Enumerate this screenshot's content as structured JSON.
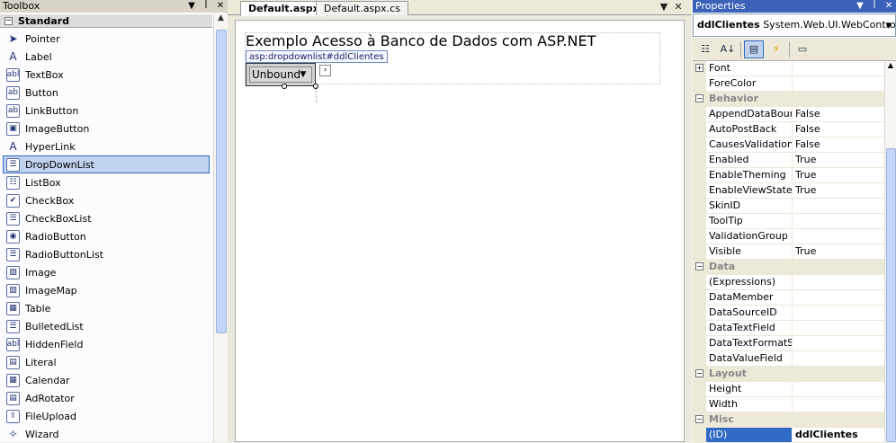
{
  "toolbox": {
    "title": "Toolbox",
    "group": "Standard",
    "items": [
      {
        "label": "Pointer",
        "icon": "pointer-icon",
        "glyph": "➤"
      },
      {
        "label": "Label",
        "icon": "label-icon",
        "glyph": "A"
      },
      {
        "label": "TextBox",
        "icon": "textbox-icon",
        "glyph": "abl"
      },
      {
        "label": "Button",
        "icon": "button-icon",
        "glyph": "ab"
      },
      {
        "label": "LinkButton",
        "icon": "linkbutton-icon",
        "glyph": "ab"
      },
      {
        "label": "ImageButton",
        "icon": "imagebutton-icon",
        "glyph": "▣"
      },
      {
        "label": "HyperLink",
        "icon": "hyperlink-icon",
        "glyph": "A"
      },
      {
        "label": "DropDownList",
        "icon": "dropdownlist-icon",
        "glyph": "☰"
      },
      {
        "label": "ListBox",
        "icon": "listbox-icon",
        "glyph": "☷"
      },
      {
        "label": "CheckBox",
        "icon": "checkbox-icon",
        "glyph": "✔"
      },
      {
        "label": "CheckBoxList",
        "icon": "checkboxlist-icon",
        "glyph": "☰"
      },
      {
        "label": "RadioButton",
        "icon": "radiobutton-icon",
        "glyph": "◉"
      },
      {
        "label": "RadioButtonList",
        "icon": "radiobuttonlist-icon",
        "glyph": "☰"
      },
      {
        "label": "Image",
        "icon": "image-icon",
        "glyph": "▨"
      },
      {
        "label": "ImageMap",
        "icon": "imagemap-icon",
        "glyph": "▧"
      },
      {
        "label": "Table",
        "icon": "table-icon",
        "glyph": "▦"
      },
      {
        "label": "BulletedList",
        "icon": "bulletedlist-icon",
        "glyph": "☰"
      },
      {
        "label": "HiddenField",
        "icon": "hiddenfield-icon",
        "glyph": "abl"
      },
      {
        "label": "Literal",
        "icon": "literal-icon",
        "glyph": "▤"
      },
      {
        "label": "Calendar",
        "icon": "calendar-icon",
        "glyph": "▦"
      },
      {
        "label": "AdRotator",
        "icon": "adrotator-icon",
        "glyph": "▤"
      },
      {
        "label": "FileUpload",
        "icon": "fileupload-icon",
        "glyph": "⇪"
      },
      {
        "label": "Wizard",
        "icon": "wizard-icon",
        "glyph": "✧"
      }
    ],
    "selected_index": 7
  },
  "editor": {
    "tabs": [
      "Default.aspx",
      "Default.aspx.cs"
    ],
    "active_tab": 0,
    "heading": "Exemplo Acesso à Banco de Dados com ASP.NET",
    "tag_tip": "asp:dropdownlist#ddlClientes",
    "dropdown_value": "Unbound"
  },
  "properties": {
    "title": "Properties",
    "object_name": "ddlClientes",
    "object_type": "System.Web.UI.WebControls",
    "rows": [
      {
        "type": "prop",
        "expand": "+",
        "name": "Font",
        "value": ""
      },
      {
        "type": "prop",
        "name": "ForeColor",
        "value": ""
      },
      {
        "type": "cat",
        "name": "Behavior"
      },
      {
        "type": "prop",
        "name": "AppendDataBound",
        "value": "False"
      },
      {
        "type": "prop",
        "name": "AutoPostBack",
        "value": "False"
      },
      {
        "type": "prop",
        "name": "CausesValidation",
        "value": "False"
      },
      {
        "type": "prop",
        "name": "Enabled",
        "value": "True"
      },
      {
        "type": "prop",
        "name": "EnableTheming",
        "value": "True"
      },
      {
        "type": "prop",
        "name": "EnableViewState",
        "value": "True"
      },
      {
        "type": "prop",
        "name": "SkinID",
        "value": ""
      },
      {
        "type": "prop",
        "name": "ToolTip",
        "value": ""
      },
      {
        "type": "prop",
        "name": "ValidationGroup",
        "value": ""
      },
      {
        "type": "prop",
        "name": "Visible",
        "value": "True"
      },
      {
        "type": "cat",
        "name": "Data"
      },
      {
        "type": "prop",
        "name": "(Expressions)",
        "value": ""
      },
      {
        "type": "prop",
        "name": "DataMember",
        "value": ""
      },
      {
        "type": "prop",
        "name": "DataSourceID",
        "value": ""
      },
      {
        "type": "prop",
        "name": "DataTextField",
        "value": ""
      },
      {
        "type": "prop",
        "name": "DataTextFormatStr",
        "value": ""
      },
      {
        "type": "prop",
        "name": "DataValueField",
        "value": ""
      },
      {
        "type": "cat",
        "name": "Layout"
      },
      {
        "type": "prop",
        "name": "Height",
        "value": ""
      },
      {
        "type": "prop",
        "name": "Width",
        "value": ""
      },
      {
        "type": "cat",
        "name": "Misc"
      },
      {
        "type": "prop",
        "name": "(ID)",
        "value": "ddlClientes",
        "selected": true
      }
    ]
  }
}
